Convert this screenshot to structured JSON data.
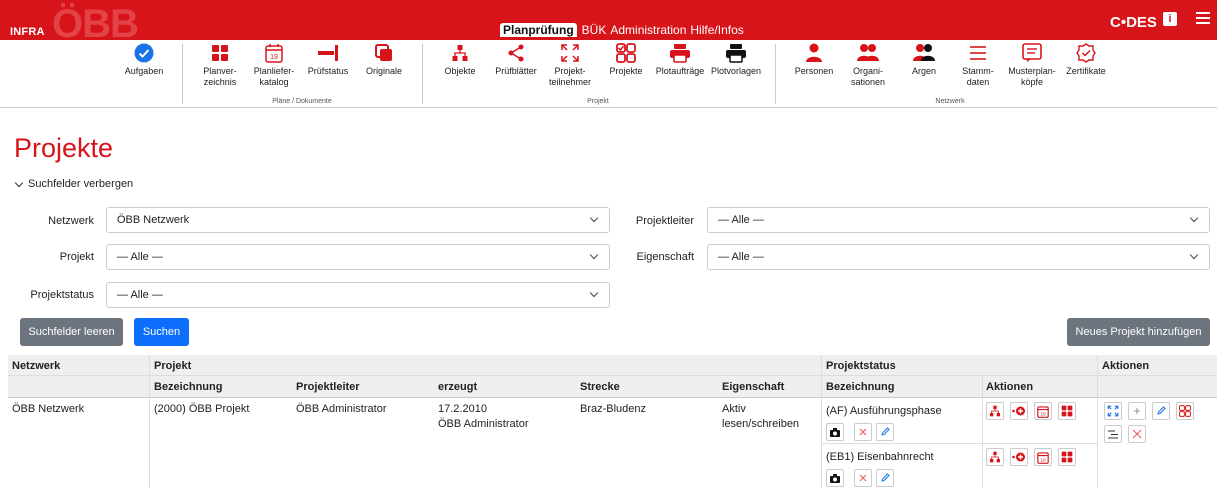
{
  "header": {
    "brand": "INFRA",
    "brand_mark": "ÖBB",
    "tabs": [
      "Planprüfung",
      "BÜK",
      "Administration",
      "Hilfe/Infos"
    ],
    "active_tab": "Planprüfung",
    "codes_logo": "C•DES",
    "info_icon": "i"
  },
  "toolbar": {
    "groups": [
      {
        "label": "",
        "items": [
          {
            "label": "Aufgaben",
            "icon": "check-circle-icon"
          }
        ]
      },
      {
        "label": "Pläne / Dokumente",
        "items": [
          {
            "label": "Planver-\nzeichnis",
            "icon": "grid-icon"
          },
          {
            "label": "Planliefer-\nkatalog",
            "icon": "calendar-icon"
          },
          {
            "label": "Prüfstatus",
            "icon": "status-bar-icon"
          },
          {
            "label": "Originale",
            "icon": "copy-icon"
          }
        ]
      },
      {
        "label": "Projekt",
        "items": [
          {
            "label": "Objekte",
            "icon": "hierarchy-icon"
          },
          {
            "label": "Prüfblätter",
            "icon": "share-icon"
          },
          {
            "label": "Projekt-\nteilnehmer",
            "icon": "expand-arrows-icon"
          },
          {
            "label": "Projekte",
            "icon": "projects-grid-icon"
          },
          {
            "label": "Plotaufträge",
            "icon": "printer-red-icon"
          },
          {
            "label": "Plotvorlagen",
            "icon": "printer-black-icon"
          }
        ]
      },
      {
        "label": "Netzwerk",
        "items": [
          {
            "label": "Personen",
            "icon": "person-icon"
          },
          {
            "label": "Organi-\nsationen",
            "icon": "users-red-icon"
          },
          {
            "label": "Argen",
            "icon": "users-black-icon"
          },
          {
            "label": "Stamm-\ndaten",
            "icon": "list-icon"
          },
          {
            "label": "Musterplan-\nköpfe",
            "icon": "document-list-icon"
          },
          {
            "label": "Zertifikate",
            "icon": "certificate-icon"
          }
        ]
      }
    ]
  },
  "page": {
    "title": "Projekte",
    "toggle_search": "Suchfelder verbergen"
  },
  "filters": {
    "netzwerk": {
      "label": "Netzwerk",
      "value": "ÖBB Netzwerk"
    },
    "projekt": {
      "label": "Projekt",
      "value": "— Alle —"
    },
    "projektstatus": {
      "label": "Projektstatus",
      "value": "— Alle —"
    },
    "projektleiter": {
      "label": "Projektleiter",
      "value": "— Alle —"
    },
    "eigenschaft": {
      "label": "Eigenschaft",
      "value": "— Alle —"
    }
  },
  "buttons": {
    "clear": "Suchfelder leeren",
    "search": "Suchen",
    "add_project": "Neues Projekt hinzufügen"
  },
  "table": {
    "group_headers": {
      "netzwerk": "Netzwerk",
      "projekt": "Projekt",
      "projektstatus": "Projektstatus",
      "aktionen": "Aktionen"
    },
    "sub_headers": {
      "bezeichnung": "Bezeichnung",
      "projektleiter": "Projektleiter",
      "erzeugt": "erzeugt",
      "strecke": "Strecke",
      "eigenschaft": "Eigenschaft",
      "status_bezeichnung": "Bezeichnung",
      "status_aktionen": "Aktionen"
    },
    "rows": [
      {
        "netzwerk": "ÖBB Netzwerk",
        "bezeichnung": "(2000) ÖBB Projekt",
        "projektleiter": "ÖBB Administrator",
        "erzeugt_date": "17.2.2010",
        "erzeugt_by": "ÖBB Administrator",
        "strecke": "Braz-Bludenz",
        "eigenschaft_1": "Aktiv",
        "eigenschaft_2": "lesen/schreiben",
        "statuses": [
          {
            "bezeichnung": "(AF) Ausführungsphase"
          },
          {
            "bezeichnung": "(EB1) Eisenbahnrecht"
          }
        ]
      }
    ]
  },
  "colors": {
    "brand_red": "#d7141a",
    "primary_blue": "#0d6efd",
    "grey_button": "#6c757d"
  }
}
